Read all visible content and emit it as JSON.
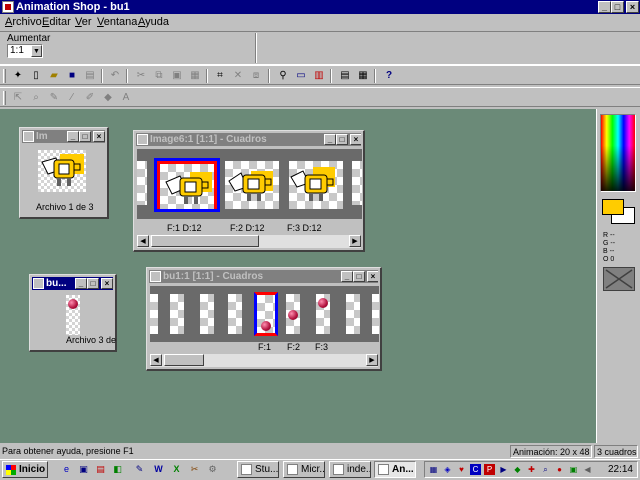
{
  "window": {
    "title": "Animation Shop - bu1"
  },
  "menu": {
    "items": [
      "Archivo",
      "Editar",
      "Ver",
      "Ventana",
      "Ayuda"
    ]
  },
  "zoom": {
    "label": "Aumentar",
    "value": "1:1"
  },
  "toolbar1": {
    "icons": [
      "wizard-icon",
      "new-icon",
      "open-icon",
      "save-icon",
      "print-icon",
      "undo-icon",
      "cut-icon",
      "copy-icon",
      "paste-icon",
      "paste-frame-icon",
      "crop-icon",
      "delete-icon",
      "transition-icon",
      "magnify-icon",
      "frame-props-icon",
      "palette-icon",
      "view-anim-icon",
      "storyboard-icon",
      "help-icon"
    ]
  },
  "toolbar2": {
    "icons": [
      "select-arrow-icon",
      "zoom-icon",
      "dropper-icon",
      "pencil-icon",
      "brush-icon",
      "fill-icon",
      "eraser-icon",
      "text-icon"
    ],
    "glyphs": [
      "⇱",
      "⌕",
      "✎",
      "∕",
      "✐",
      "◆",
      "▰",
      "A"
    ]
  },
  "windows": {
    "img_small": {
      "title": "Im",
      "caption": "Archivo 1 de 3"
    },
    "image6": {
      "title": "Image6:1 [1:1] - Cuadros",
      "frames": [
        {
          "label": "F:1  D:12",
          "selected": true
        },
        {
          "label": "F:2  D:12",
          "selected": false
        },
        {
          "label": "F:3  D:12",
          "selected": false
        }
      ]
    },
    "bu_small": {
      "title": "bu...",
      "caption": "Archivo 3 de"
    },
    "bu1": {
      "title": "bu1:1 [1:1] - Cuadros",
      "frames": [
        {
          "label": "F:1",
          "selected": true
        },
        {
          "label": "F:2",
          "selected": false
        },
        {
          "label": "F:3",
          "selected": false
        }
      ]
    }
  },
  "palette": {
    "r": "R --",
    "g": "G --",
    "b": "B --",
    "o": "O 0",
    "fg_color": "#ffcc00",
    "bg_color": "#ffffff"
  },
  "status": {
    "help": "Para obtener ayuda, presione F1",
    "animation": "Animación: 20 x 48",
    "frames": "3 cuadros"
  },
  "taskbar": {
    "start": "Inicio",
    "tasks": [
      "Stu...",
      "Micr...",
      "inde...",
      "An..."
    ],
    "clock": "22:14"
  }
}
